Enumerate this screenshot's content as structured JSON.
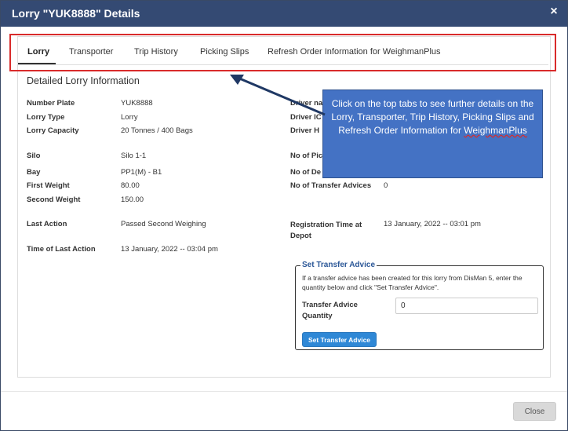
{
  "dialog": {
    "title": "Lorry \"YUK8888\" Details",
    "close_icon": "×"
  },
  "tabs": [
    {
      "label": "Lorry",
      "active": true
    },
    {
      "label": "Transporter"
    },
    {
      "label": "Trip History"
    },
    {
      "label": "Picking Slips"
    },
    {
      "label": "Refresh Order Information for WeighmanPlus"
    }
  ],
  "section_title": "Detailed Lorry Information",
  "fields_left": [
    {
      "label": "Number Plate",
      "value": "YUK8888"
    },
    {
      "label": "Lorry Type",
      "value": "Lorry"
    },
    {
      "label": "Lorry Capacity",
      "value": "20 Tonnes / 400 Bags"
    },
    {
      "label": "Silo",
      "value": "Silo 1-1"
    },
    {
      "label": "Bay",
      "value": "PP1(M) - B1"
    },
    {
      "label": "First Weight",
      "value": "80.00"
    },
    {
      "label": "Second Weight",
      "value": "150.00"
    },
    {
      "label": "Last Action",
      "value": "Passed Second Weighing"
    },
    {
      "label": "Time of Last Action",
      "value": "13 January, 2022 -- 03:04 pm"
    }
  ],
  "fields_right": [
    {
      "label": "Driver na"
    },
    {
      "label": "Driver IC"
    },
    {
      "label": "Driver H"
    },
    {
      "label": "No of Pic"
    },
    {
      "label": "No of De"
    },
    {
      "label": "No of Transfer Advices",
      "value": "0"
    },
    {
      "label": "Registration Time at Depot",
      "value": "13 January, 2022 -- 03:01 pm"
    }
  ],
  "callout": {
    "text_main": "Click on the top tabs to see further details on the Lorry, Transporter, Trip History, Picking Slips and Refresh Order Information for ",
    "text_underlined": "WeighmanPlus"
  },
  "transfer": {
    "legend": "Set Transfer Advice",
    "help": "If a transfer advice has been created for this lorry from DisMan 5, enter the quantity below and click \"Set Transfer Advice\".",
    "quantity_label": "Transfer Advice Quantity",
    "quantity_value": "0",
    "button_label": "Set Transfer Advice"
  },
  "footer": {
    "close_label": "Close"
  },
  "colors": {
    "titlebar": "#344a73",
    "highlight": "#d92b2b",
    "callout": "#4472c4",
    "arrow": "#1f3864",
    "button": "#2f88d6"
  }
}
